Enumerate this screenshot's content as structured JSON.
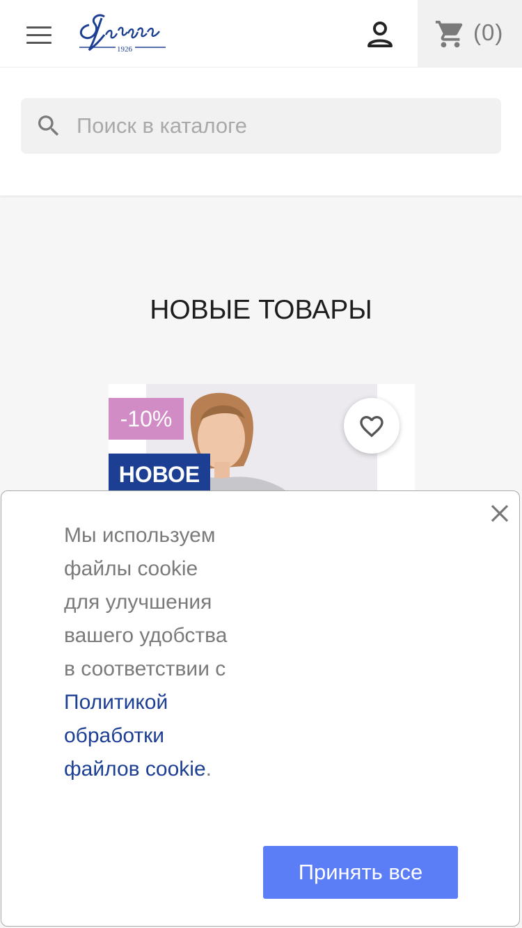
{
  "header": {
    "logo_text": "Zarya 1926",
    "cart_count": "(0)"
  },
  "search": {
    "placeholder": "Поиск в каталоге"
  },
  "main": {
    "section_title": "НОВЫЕ ТОВАРЫ",
    "product": {
      "discount_badge": "-10%",
      "new_badge": "НОВОЕ"
    }
  },
  "cookie": {
    "text_prefix": "Мы используем файлы cookie для улучшения вашего удобства в соответствии с ",
    "link_text": "Политикой обработки файлов cookie",
    "text_suffix": ".",
    "accept_label": "Принять все"
  },
  "colors": {
    "brand_blue": "#1c3f94",
    "discount_pink": "#d18cc5",
    "accept_blue": "#5b7ef6"
  },
  "icons": [
    "menu-icon",
    "user-icon",
    "cart-icon",
    "search-icon",
    "heart-icon",
    "close-icon"
  ]
}
